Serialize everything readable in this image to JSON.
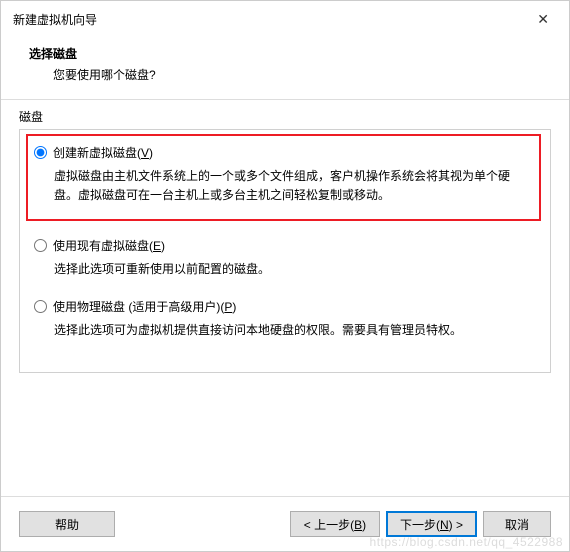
{
  "window": {
    "title": "新建虚拟机向导"
  },
  "header": {
    "title": "选择磁盘",
    "subtitle": "您要使用哪个磁盘?"
  },
  "group": {
    "label": "磁盘"
  },
  "options": {
    "create": {
      "label_pre": "创建新虚拟磁盘(",
      "key": "V",
      "label_post": ")",
      "desc": "虚拟磁盘由主机文件系统上的一个或多个文件组成，客户机操作系统会将其视为单个硬盘。虚拟磁盘可在一台主机上或多台主机之间轻松复制或移动。"
    },
    "existing": {
      "label_pre": "使用现有虚拟磁盘(",
      "key": "E",
      "label_post": ")",
      "desc": "选择此选项可重新使用以前配置的磁盘。"
    },
    "physical": {
      "label_pre": "使用物理磁盘 (适用于高级用户)(",
      "key": "P",
      "label_post": ")",
      "desc": "选择此选项可为虚拟机提供直接访问本地硬盘的权限。需要具有管理员特权。"
    }
  },
  "buttons": {
    "help": "帮助",
    "back_pre": "< 上一步(",
    "back_key": "B",
    "back_post": ")",
    "next_pre": "下一步(",
    "next_key": "N",
    "next_post": ") >",
    "cancel": "取消"
  },
  "watermark": "https://blog.csdn.net/qq_4522988"
}
